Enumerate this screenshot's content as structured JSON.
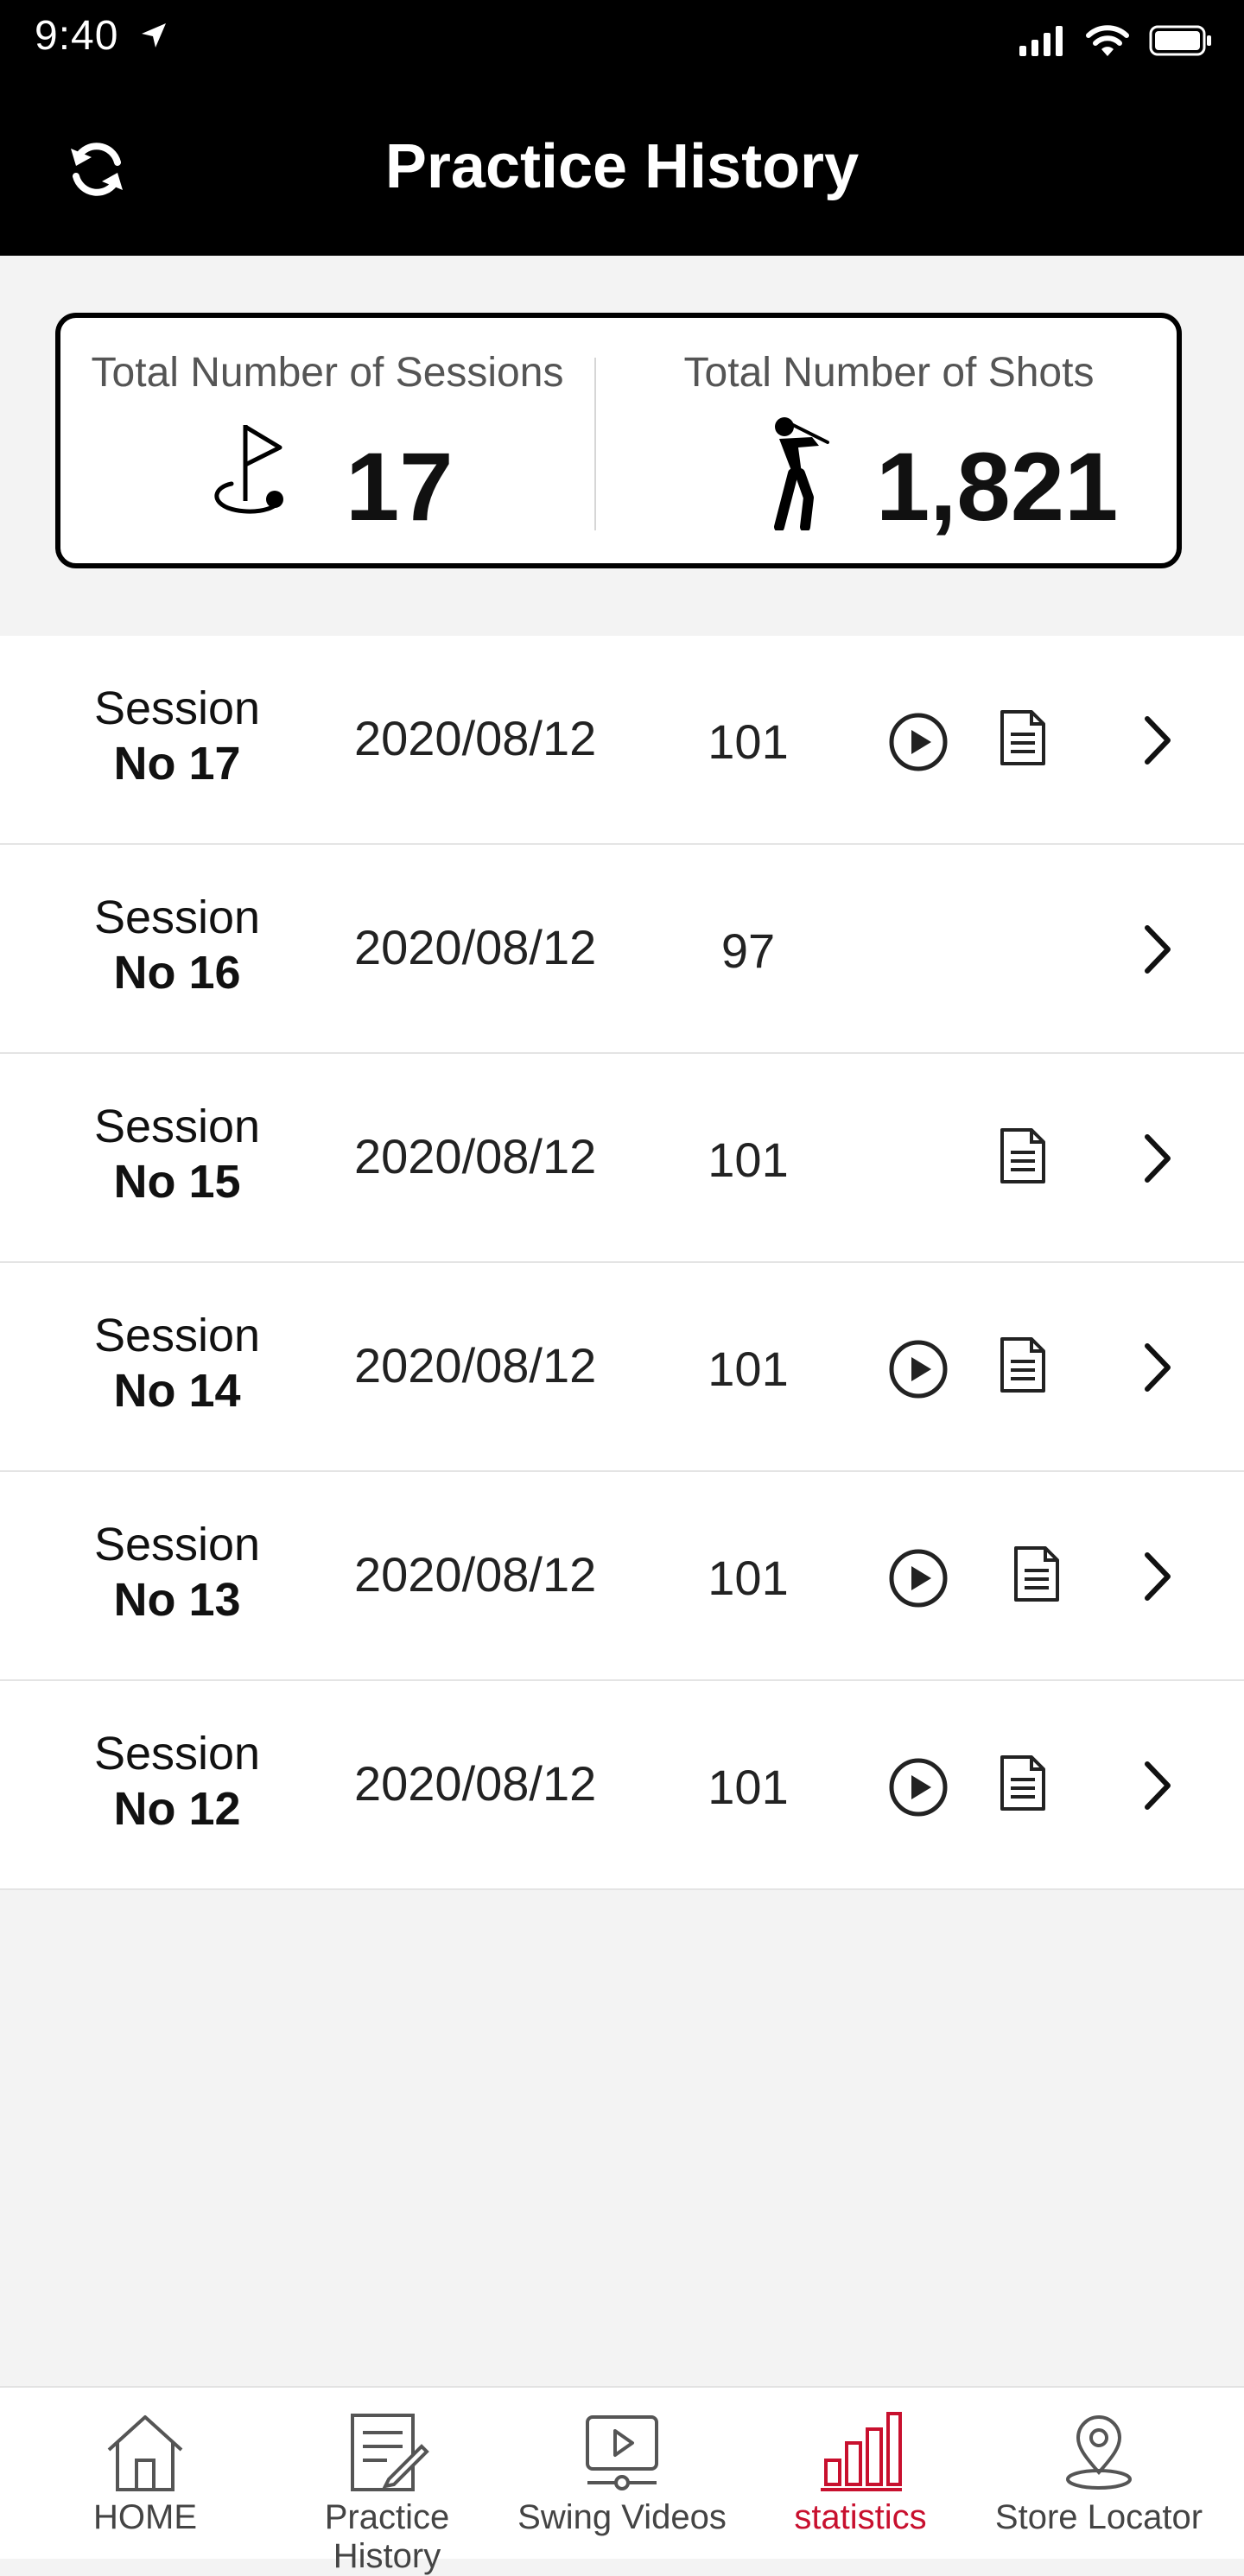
{
  "status_bar": {
    "time": "9:40",
    "icons": [
      "location-arrow-icon",
      "signal-icon",
      "wifi-icon",
      "battery-icon"
    ]
  },
  "nav": {
    "title": "Practice History",
    "left_icon": "refresh-icon"
  },
  "summary": {
    "sessions_label": "Total Number of Sessions",
    "sessions_value": "17",
    "sessions_icon": "golf-flag-icon",
    "shots_label": "Total Number of Shots",
    "shots_value": "1,821",
    "shots_icon": "golfer-icon"
  },
  "sessions": [
    {
      "label": "Session",
      "number": "No 17",
      "date": "2020/08/12",
      "shots": "101",
      "has_video": true,
      "has_report": true
    },
    {
      "label": "Session",
      "number": "No 16",
      "date": "2020/08/12",
      "shots": "97",
      "has_video": false,
      "has_report": false
    },
    {
      "label": "Session",
      "number": "No 15",
      "date": "2020/08/12",
      "shots": "101",
      "has_video": false,
      "has_report": true
    },
    {
      "label": "Session",
      "number": "No 14",
      "date": "2020/08/12",
      "shots": "101",
      "has_video": true,
      "has_report": true
    },
    {
      "label": "Session",
      "number": "No 13",
      "date": "2020/08/12",
      "shots": "101",
      "has_video": true,
      "has_report": true
    },
    {
      "label": "Session",
      "number": "No 12",
      "date": "2020/08/12",
      "shots": "101",
      "has_video": true,
      "has_report": true
    }
  ],
  "tabs": [
    {
      "label": "HOME",
      "icon": "home-icon",
      "active": false
    },
    {
      "label": "Practice History",
      "icon": "practice-history-icon",
      "active": false
    },
    {
      "label": "Swing Videos",
      "icon": "swing-videos-icon",
      "active": false
    },
    {
      "label": "statistics",
      "icon": "statistics-icon",
      "active": true
    },
    {
      "label": "Store Locator",
      "icon": "store-locator-icon",
      "active": false
    }
  ],
  "colors": {
    "header_bg": "#000000",
    "active_tab": "#c8102e",
    "page_bg": "#f3f3f3"
  }
}
